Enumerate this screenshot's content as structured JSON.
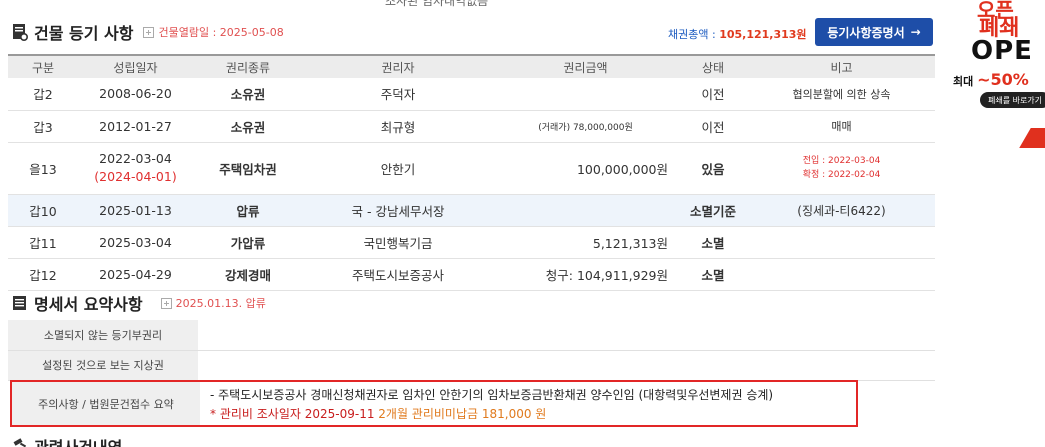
{
  "top_cut_text": "조사된 임차내역없음",
  "section1": {
    "title": "건물 등기 사항",
    "view_date": "건물열람일 : 2025-05-08",
    "debt_label": "채권총액 : ",
    "debt_value": "105,121,313원",
    "cert_button": "등기사항증명서"
  },
  "table": {
    "headers": [
      "구분",
      "성립일자",
      "권리종류",
      "권리자",
      "권리금액",
      "상태",
      "비고"
    ],
    "rows": [
      {
        "gubun": "갑2",
        "date": "2008-06-20",
        "kind": "소유권",
        "holder": "주덕자",
        "amount": "",
        "status": "이전",
        "note": "협의분할에 의한 상속"
      },
      {
        "gubun": "갑3",
        "date": "2012-01-27",
        "kind": "소유권",
        "holder": "최규형",
        "amount": "(거래가) 78,000,000원",
        "status": "이전",
        "note": "매매"
      },
      {
        "gubun": "을13",
        "date": "2022-03-04",
        "date2": "(2024-04-01)",
        "kind": "주택임차권",
        "holder": "안한기",
        "amount": "100,000,000원",
        "status": "있음",
        "note": "전입 : 2022-03-04",
        "note2": "확정 : 2022-02-04"
      },
      {
        "gubun": "갑10",
        "date": "2025-01-13",
        "kind": "압류",
        "holder": "국 - 강남세무서장",
        "amount": "",
        "status": "소멸기준",
        "note": "(징세과-티6422)"
      },
      {
        "gubun": "갑11",
        "date": "2025-03-04",
        "kind": "가압류",
        "holder": "국민행복기금",
        "amount": "5,121,313원",
        "status": "소멸",
        "note": ""
      },
      {
        "gubun": "갑12",
        "date": "2025-04-29",
        "kind": "강제경매",
        "holder": "주택도시보증공사",
        "amount": "청구: 104,911,929원",
        "status": "소멸",
        "note": ""
      }
    ]
  },
  "section2": {
    "title": "명세서 요약사항",
    "sub": "2025.01.13. 압류",
    "row1_label": "소멸되지 않는 등기부권리",
    "row1_value": "",
    "row2_label": "설정된 것으로 보는 지상권",
    "row2_value": "",
    "caution_label": "주의사항 / 법원문건접수 요약",
    "caution_line1": "- 주택도시보증공사 경매신청채권자로 임차인 안한기의 임차보증금반환채권 양수인임 (대항력및우선변제권 승계)",
    "caution_line2_a": "* 관리비 조사일자 2025-09-11 ",
    "caution_line2_b": "2개월 관리비미납금 181,000 원"
  },
  "section3": {
    "title": "관련사건내역"
  },
  "ad": {
    "line1": "오픈",
    "line2": "폐쇄",
    "line3": "OPE",
    "line4a": "최대 ",
    "line4b": "~50%",
    "pill": "폐쇄를 바로가기"
  },
  "colors": {
    "accent_blue": "#1e4ea8",
    "green": "#3aa83a",
    "red": "#e03030"
  }
}
